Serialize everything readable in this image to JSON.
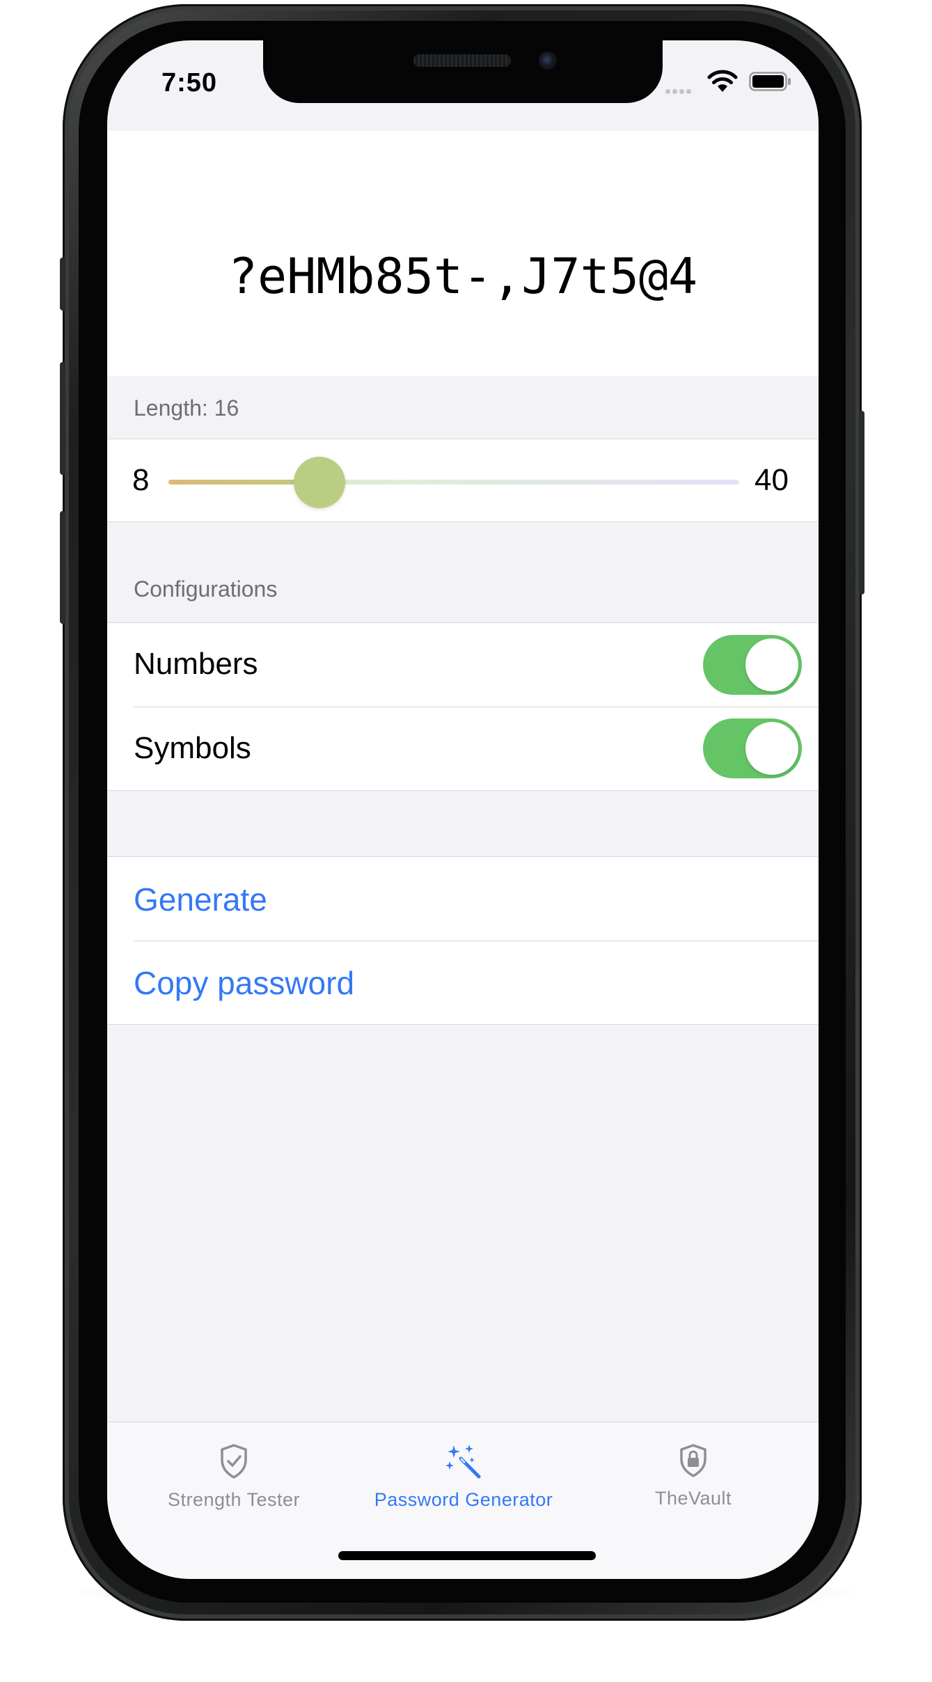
{
  "status_bar": {
    "time": "7:50"
  },
  "password": {
    "value": "?eHMb85t-,J7t5@4"
  },
  "length_section": {
    "header": "Length: 16",
    "min_label": "8",
    "max_label": "40",
    "value": 16,
    "min": 8,
    "max": 40
  },
  "configurations": {
    "header": "Configurations",
    "items": [
      {
        "label": "Numbers",
        "enabled": true
      },
      {
        "label": "Symbols",
        "enabled": true
      }
    ]
  },
  "actions": {
    "generate_label": "Generate",
    "copy_label": "Copy password"
  },
  "tab_bar": {
    "tabs": [
      {
        "label": "Strength Tester",
        "icon": "shield-check-icon",
        "selected": false
      },
      {
        "label": "Password Generator",
        "icon": "magic-wand-icon",
        "selected": true
      },
      {
        "label": "TheVault",
        "icon": "shield-lock-icon",
        "selected": false
      }
    ]
  },
  "colors": {
    "accent": "#3478f6",
    "toggle_on": "#65c466",
    "tab_inactive": "#8e8e93",
    "grouped_background": "#f2f2f7"
  }
}
